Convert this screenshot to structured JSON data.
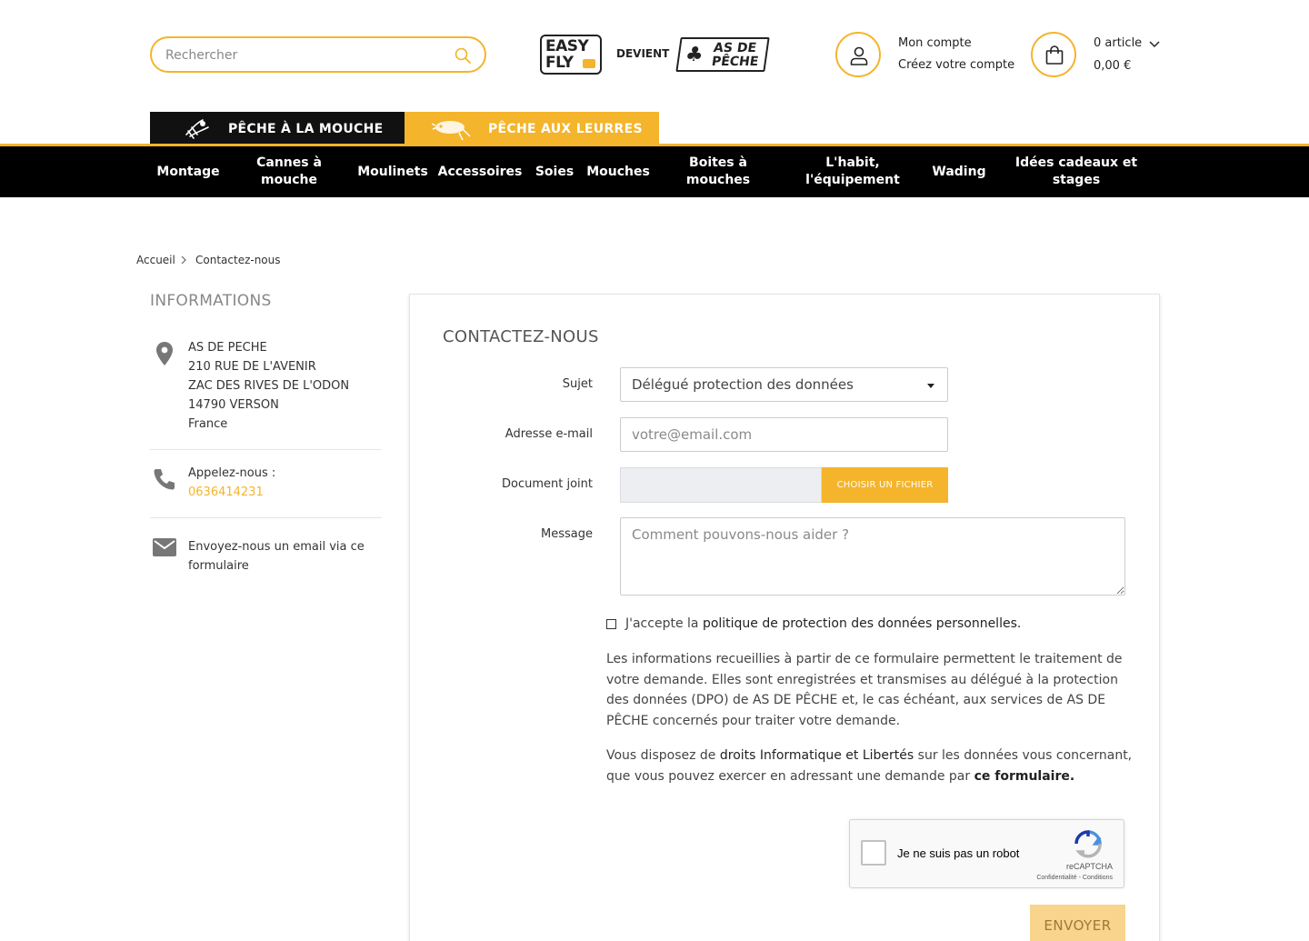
{
  "header": {
    "search": {
      "placeholder": "Rechercher"
    },
    "logo": {
      "easy_line1": "EASY",
      "easy_line2": "FLY",
      "devient": "DEVIENT",
      "asde_line1": "AS DE",
      "asde_line2": "PÊCHE"
    },
    "account": {
      "line1": "Mon compte",
      "line2": "Créez votre compte"
    },
    "cart": {
      "count_label": "0 article",
      "total": "0,00 €"
    }
  },
  "tabs": [
    {
      "label": "PÊCHE À LA MOUCHE",
      "active": true
    },
    {
      "label": "PÊCHE AUX LEURRES",
      "active": false
    }
  ],
  "nav": [
    "Montage",
    "Cannes à mouche",
    "Moulinets",
    "Accessoires",
    "Soies",
    "Mouches",
    "Boites à mouches",
    "L'habit, l'équipement",
    "Wading",
    "Idées cadeaux et stages"
  ],
  "breadcrumb": [
    "Accueil",
    "Contactez-nous"
  ],
  "info": {
    "title": "INFORMATIONS",
    "address": [
      "AS DE PECHE",
      "210 RUE DE L'AVENIR",
      "ZAC DES RIVES DE L'ODON",
      "14790 VERSON",
      "France"
    ],
    "phone_label": "Appelez-nous :",
    "phone": "0636414231",
    "email_text": "Envoyez-nous un email via ce formulaire"
  },
  "form": {
    "title": "CONTACTEZ-NOUS",
    "subject_label": "Sujet",
    "subject_value": "Délégué protection des données",
    "email_label": "Adresse e-mail",
    "email_placeholder": "votre@email.com",
    "file_label": "Document joint",
    "file_button": "CHOISIR UN FICHIER",
    "message_label": "Message",
    "message_placeholder": "Comment pouvons-nous aider ?",
    "consent_prefix": "J'accepte la ",
    "consent_link": "politique de protection des données personnelles.",
    "info_para": "Les informations recueillies à partir de ce formulaire permettent le traitement de votre demande. Elles sont enregistrées et transmises au délégué à la protection des données (DPO) de AS DE PÊCHE et, le cas échéant, aux services de AS DE PÊCHE concernés pour traiter votre demande.",
    "rights_prefix": "Vous disposez de ",
    "rights_link": "droits Informatique et Libertés",
    "rights_middle": " sur les données vous concernant, que vous pouvez exercer en adressant une demande par ",
    "rights_form_link": "ce formulaire.",
    "recaptcha_label": "Je ne suis pas un robot",
    "recaptcha_brand": "reCAPTCHA",
    "recaptcha_links": "Confidentialité - Conditions",
    "submit": "ENVOYER"
  },
  "colors": {
    "accent": "#f4b42b",
    "nav_bg": "#000000",
    "submit_disabled": "#f8d48c"
  }
}
